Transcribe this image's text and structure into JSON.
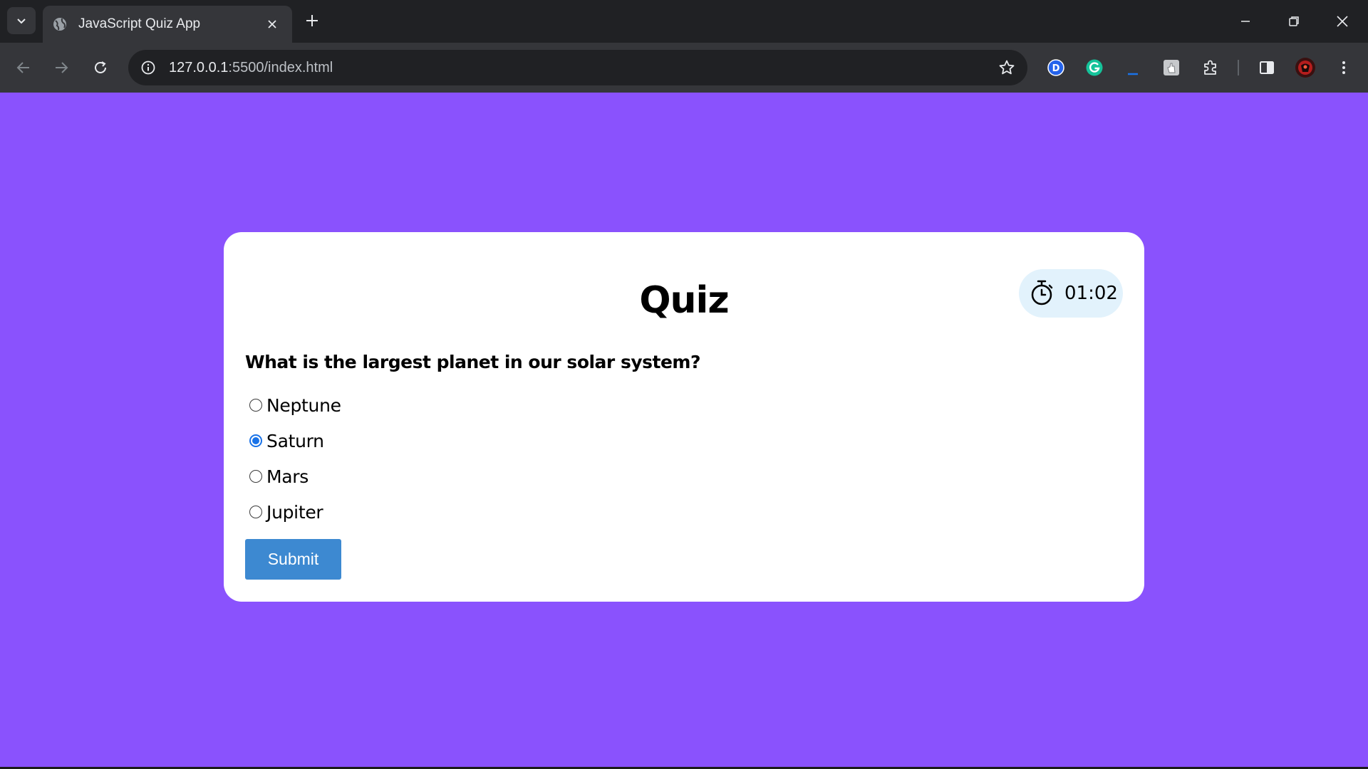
{
  "browser": {
    "tab_title": "JavaScript Quiz App",
    "url_host": "127.0.0.1",
    "url_rest": ":5500/index.html",
    "icons": [
      "tab-search-icon",
      "globe-icon",
      "close-icon",
      "plus-icon",
      "minimize-icon",
      "restore-icon",
      "close-window-icon",
      "back-icon",
      "forward-icon",
      "reload-icon",
      "info-icon",
      "star-icon",
      "extension-d-icon",
      "grammarly-icon",
      "extension-underscore-icon",
      "extension-hand-icon",
      "puzzle-icon",
      "side-panel-icon",
      "avatar-icon",
      "kebab-menu-icon"
    ]
  },
  "page": {
    "background": "#8a52fd",
    "title": "Quiz",
    "timer": {
      "value": "01:02",
      "icon": "stopwatch-icon",
      "background": "#e2f2fc"
    },
    "question": "What is the largest planet in our solar system?",
    "options": [
      {
        "label": "Neptune",
        "checked": false
      },
      {
        "label": "Saturn",
        "checked": true
      },
      {
        "label": "Mars",
        "checked": false
      },
      {
        "label": "Jupiter",
        "checked": false
      }
    ],
    "submit_label": "Submit",
    "submit_color": "#3d89d1"
  }
}
